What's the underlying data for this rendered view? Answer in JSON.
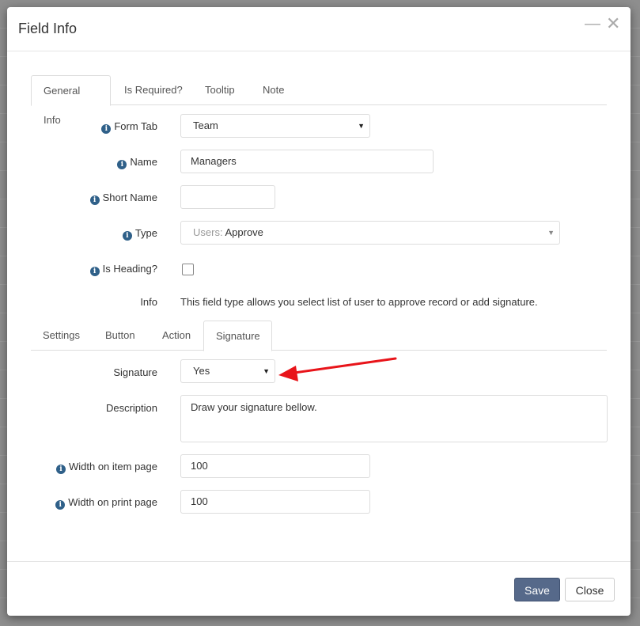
{
  "modal": {
    "title": "Field Info",
    "minimize_icon": "minimize-icon",
    "close_icon": "close-icon"
  },
  "top_tabs": [
    "General Info",
    "Is Required?",
    "Tooltip",
    "Note"
  ],
  "form": {
    "form_tab": {
      "label": "Form Tab",
      "value": "Team"
    },
    "name": {
      "label": "Name",
      "value": "Managers"
    },
    "short_name": {
      "label": "Short Name",
      "value": ""
    },
    "type": {
      "label": "Type",
      "group": "Users",
      "separator": ":",
      "value": "Approve"
    },
    "is_heading": {
      "label": "Is Heading?",
      "checked": false
    },
    "info": {
      "label": "Info",
      "text": "This field type allows you select list of user to approve record or add signature."
    }
  },
  "sub_tabs": [
    "Settings",
    "Button",
    "Action",
    "Signature"
  ],
  "signature_form": {
    "signature": {
      "label": "Signature",
      "value": "Yes"
    },
    "description": {
      "label": "Description",
      "value": "Draw your signature bellow."
    },
    "width_item": {
      "label": "Width on item page",
      "value": "100"
    },
    "width_print": {
      "label": "Width on print page",
      "value": "100"
    }
  },
  "footer": {
    "save_label": "Save",
    "close_label": "Close"
  },
  "colors": {
    "save_button": "#56698a",
    "info_icon": "#2f6089",
    "annotation_arrow": "#e8141a"
  }
}
